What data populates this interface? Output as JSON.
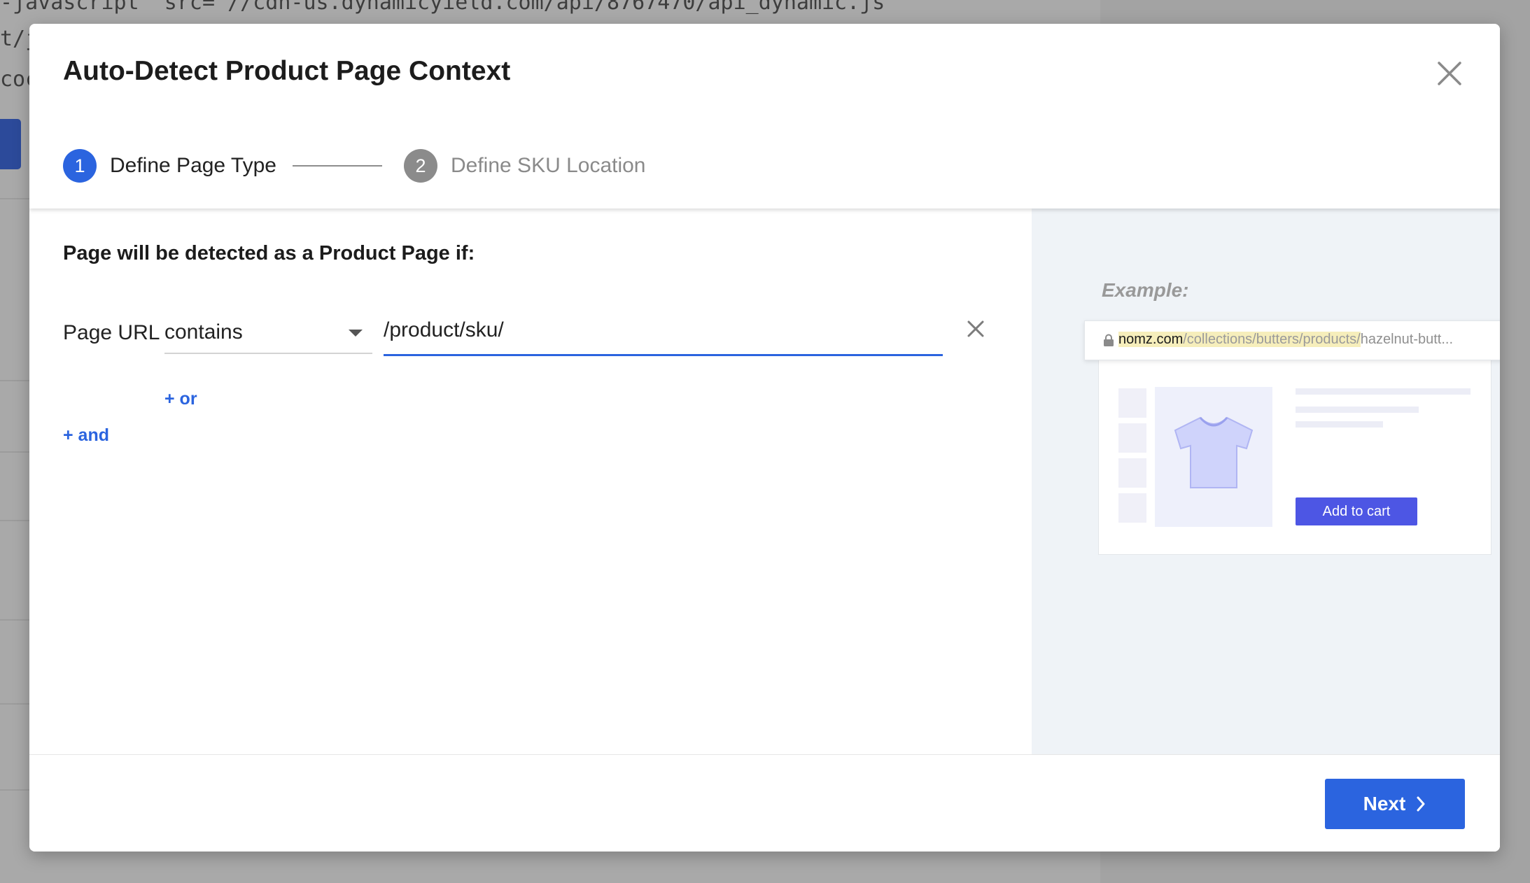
{
  "background": {
    "code_lines": [
      "-javascript\" src=\"//cdn-us.dynamicyield.com/api/8767470/api_dynamic.js",
      "t/j",
      "coc"
    ]
  },
  "modal": {
    "title": "Auto-Detect Product Page Context",
    "close_icon": "close-icon"
  },
  "steps": [
    {
      "number": "1",
      "label": "Define Page Type",
      "state": "active",
      "color": "#2b64df"
    },
    {
      "number": "2",
      "label": "Define SKU Location",
      "state": "inactive",
      "color": "#8b8b8b"
    }
  ],
  "rule": {
    "heading": "Page will be detected as a Product Page if:",
    "field_label": "Page URL",
    "operator": "contains",
    "value": "/product/sku/",
    "remove_icon": "close-icon",
    "or_label": "+ or",
    "and_label": "+ and"
  },
  "example": {
    "label": "Example:",
    "url_domain": "nomz.com",
    "url_path": "/collections/butters/products/",
    "url_rest": "hazelnut-butt...",
    "add_to_cart": "Add to cart",
    "product_icon": "tshirt-icon",
    "lock_icon": "lock-icon"
  },
  "footer": {
    "next_label": "Next",
    "next_icon": "chevron-right-icon"
  },
  "colors": {
    "accent": "#2b64df",
    "cart_button": "#4d56e4",
    "url_highlight": "#f6eebb"
  }
}
